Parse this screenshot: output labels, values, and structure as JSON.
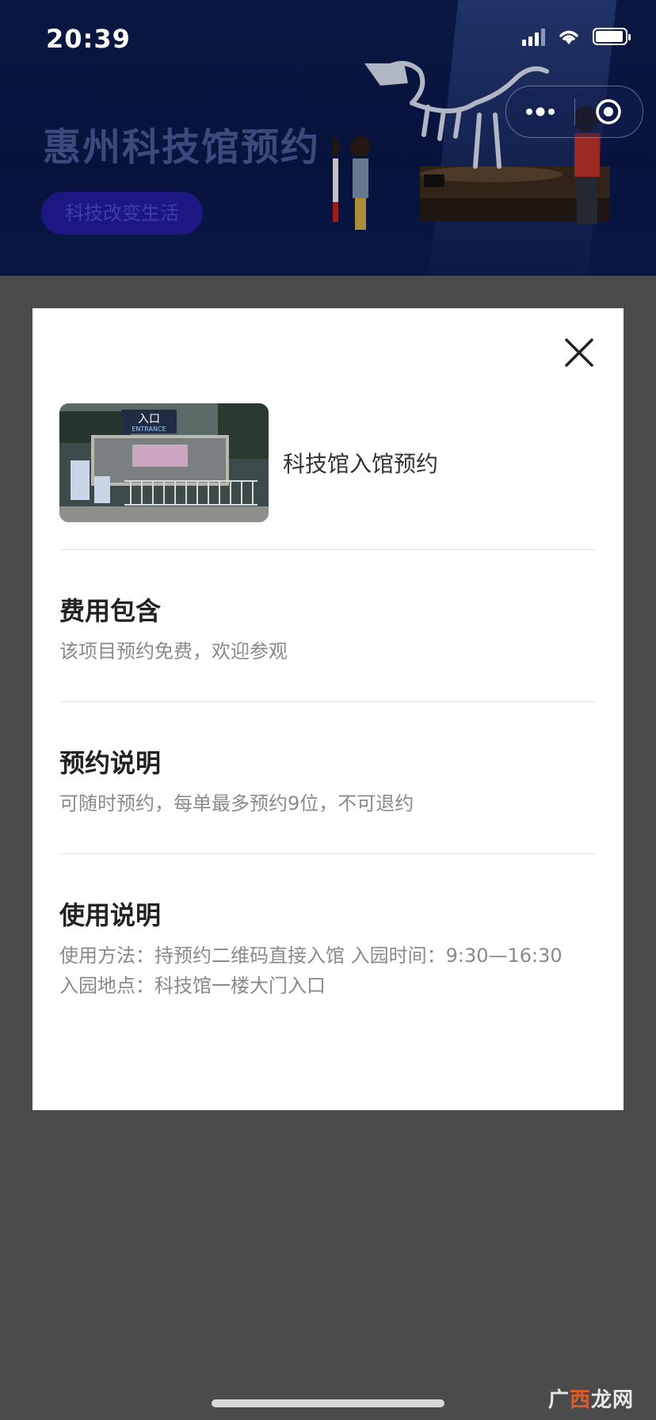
{
  "status_bar": {
    "time": "20:39"
  },
  "hero": {
    "title": "惠州科技馆预约",
    "tag": "科技改变生活"
  },
  "modal": {
    "product_name": "科技馆入馆预约",
    "sections": [
      {
        "title": "费用包含",
        "lines": [
          "该项目预约免费，欢迎参观"
        ]
      },
      {
        "title": "预约说明",
        "lines": [
          "可随时预约，每单最多预约9位，不可退约"
        ]
      },
      {
        "title": "使用说明",
        "lines": [
          "使用方法：持预约二维码直接入馆 入园时间：9:30—16:30",
          "入园地点：科技馆一楼大门入口"
        ]
      }
    ],
    "thumb_sign": "入口",
    "thumb_sign_en": "ENTRANCE"
  },
  "watermark": {
    "part1": "广",
    "part2": "西",
    "part3": "龙网"
  },
  "colors": {
    "hero_bg": "#0b1b4e",
    "backdrop": "#4b4b4b",
    "tag_bg": "#1c1783"
  }
}
